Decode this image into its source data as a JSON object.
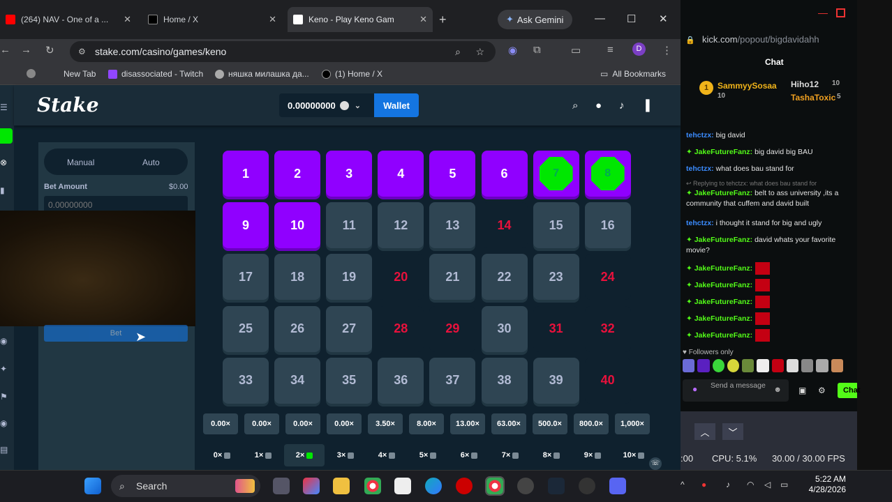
{
  "browser": {
    "tabs": [
      {
        "label": "(264) NAV - One of a ...",
        "close": "✕"
      },
      {
        "label": "Home / X",
        "close": "✕"
      },
      {
        "label": "Keno - Play Keno Gam",
        "close": "✕"
      }
    ],
    "new_tab": "+",
    "gemini": "Ask Gemini",
    "window_buttons": [
      "—",
      "☐",
      "✕"
    ],
    "url": "stake.com/casino/games/keno",
    "profile": "D",
    "bookmarks": [
      "New Tab",
      "disassociated - Twitch",
      "няшка милашка да...",
      "(1) Home / X"
    ],
    "all_bookmarks": "All Bookmarks"
  },
  "stake": {
    "logo": "Stake",
    "balance": "0.00000000",
    "wallet": "Wallet",
    "modes": [
      "Manual",
      "Auto"
    ],
    "bet_amount_label": "Bet Amount",
    "bet_amount_value": "$0.00",
    "bet_input": "0.00000000",
    "bet_button": "Bet",
    "tiles": {
      "selected": [
        1,
        2,
        3,
        4,
        5,
        6,
        9,
        10
      ],
      "hits": [
        7,
        8
      ],
      "misses": [
        14,
        20,
        24,
        28,
        29,
        31,
        32,
        40
      ]
    },
    "multipliers": [
      "0.00×",
      "0.00×",
      "0.00×",
      "0.00×",
      "3.50×",
      "8.00×",
      "13.00×",
      "63.00×",
      "500.0×",
      "800.0×",
      "1,000×"
    ],
    "hit_labels": [
      "0×",
      "1×",
      "2×",
      "3×",
      "4×",
      "5×",
      "6×",
      "7×",
      "8×",
      "9×",
      "10×"
    ],
    "active_hit_index": 2
  },
  "kick": {
    "url_prefix": "kick.com",
    "url_path": "/popout/bigdavidahh",
    "title": "Chat",
    "leaders": [
      {
        "name": "SammyySosaa",
        "count": "10"
      },
      {
        "name": "Hiho12",
        "count": "10"
      },
      {
        "name": "TashaToxic",
        "count": "5"
      }
    ],
    "messages": [
      {
        "user": "tehctzx",
        "text": "big david"
      },
      {
        "user": "JakeFutureFanz",
        "text": "big david big BAU"
      },
      {
        "user": "tehctzx",
        "text": "what does bau stand for"
      },
      {
        "user": "JakeFutureFanz",
        "text": "belt to ass university ,its a community that cuffem and david built",
        "reply": "Replying to tehctzx: what does bau stand for"
      },
      {
        "user": "tehctzx",
        "text": "i thought it stand for big and ugly"
      },
      {
        "user": "JakeFutureFanz",
        "text": "david whats your favorite movie?"
      },
      {
        "user": "JakeFutureFanz",
        "text": ""
      },
      {
        "user": "JakeFutureFanz",
        "text": ""
      },
      {
        "user": "JakeFutureFanz",
        "text": ""
      },
      {
        "user": "JakeFutureFanz",
        "text": ""
      },
      {
        "user": "JakeFutureFanz",
        "text": ""
      }
    ],
    "followers_only": "Followers only",
    "send_placeholder": "Send a message",
    "chat_button": "Chat"
  },
  "obs": {
    "cpu": "CPU: 5.1%",
    "fps": "30.00 / 30.00 FPS",
    "time": ":00"
  },
  "taskbar": {
    "search": "Search",
    "time": "5:22 AM",
    "date": "4/28/2026"
  },
  "colors": {
    "stake_bg": "#0f212e",
    "tile": "#2f4553",
    "selected": "#9000ff",
    "gem": "#00e701",
    "miss": "#e9113c",
    "kick_green": "#53fc18"
  }
}
